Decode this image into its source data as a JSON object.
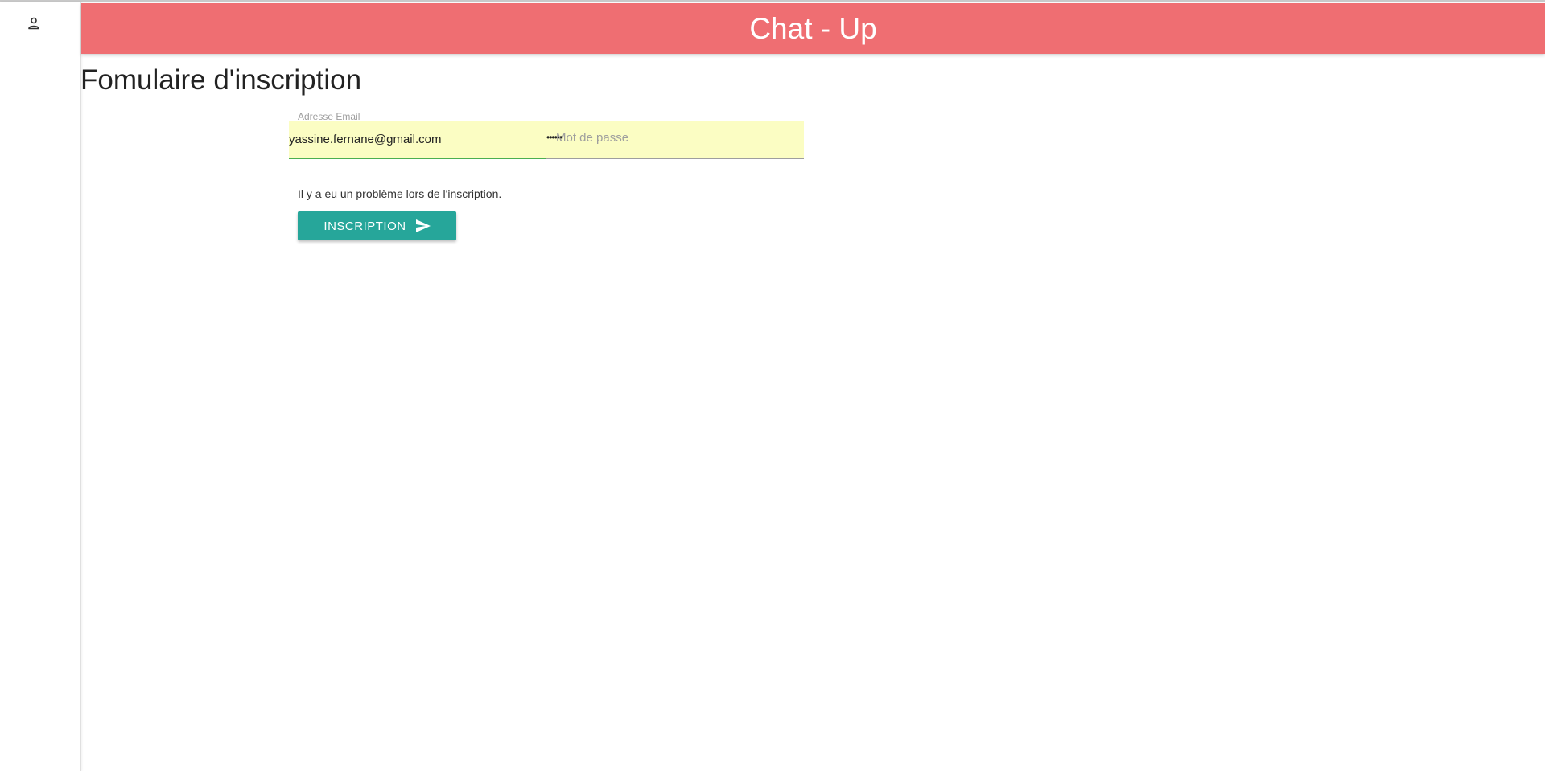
{
  "header": {
    "title": "Chat - Up"
  },
  "sidebar": {
    "icon": "person-outline-icon"
  },
  "page": {
    "title": "Fomulaire d'inscription"
  },
  "form": {
    "email": {
      "label": "Adresse Email",
      "value": "yassine.fernane@gmail.com"
    },
    "password": {
      "placeholder": "Mot de passe",
      "masked_value": "••••••"
    },
    "error_message": "Il y a eu un problème lors de l'inscription.",
    "submit_label": "INSCRIPTION",
    "submit_icon": "send-icon"
  },
  "colors": {
    "header_bg": "#ef6e72",
    "button_bg": "#26a69a",
    "autofill_bg": "#fbfdc3",
    "focus_line": "#4caf50"
  }
}
